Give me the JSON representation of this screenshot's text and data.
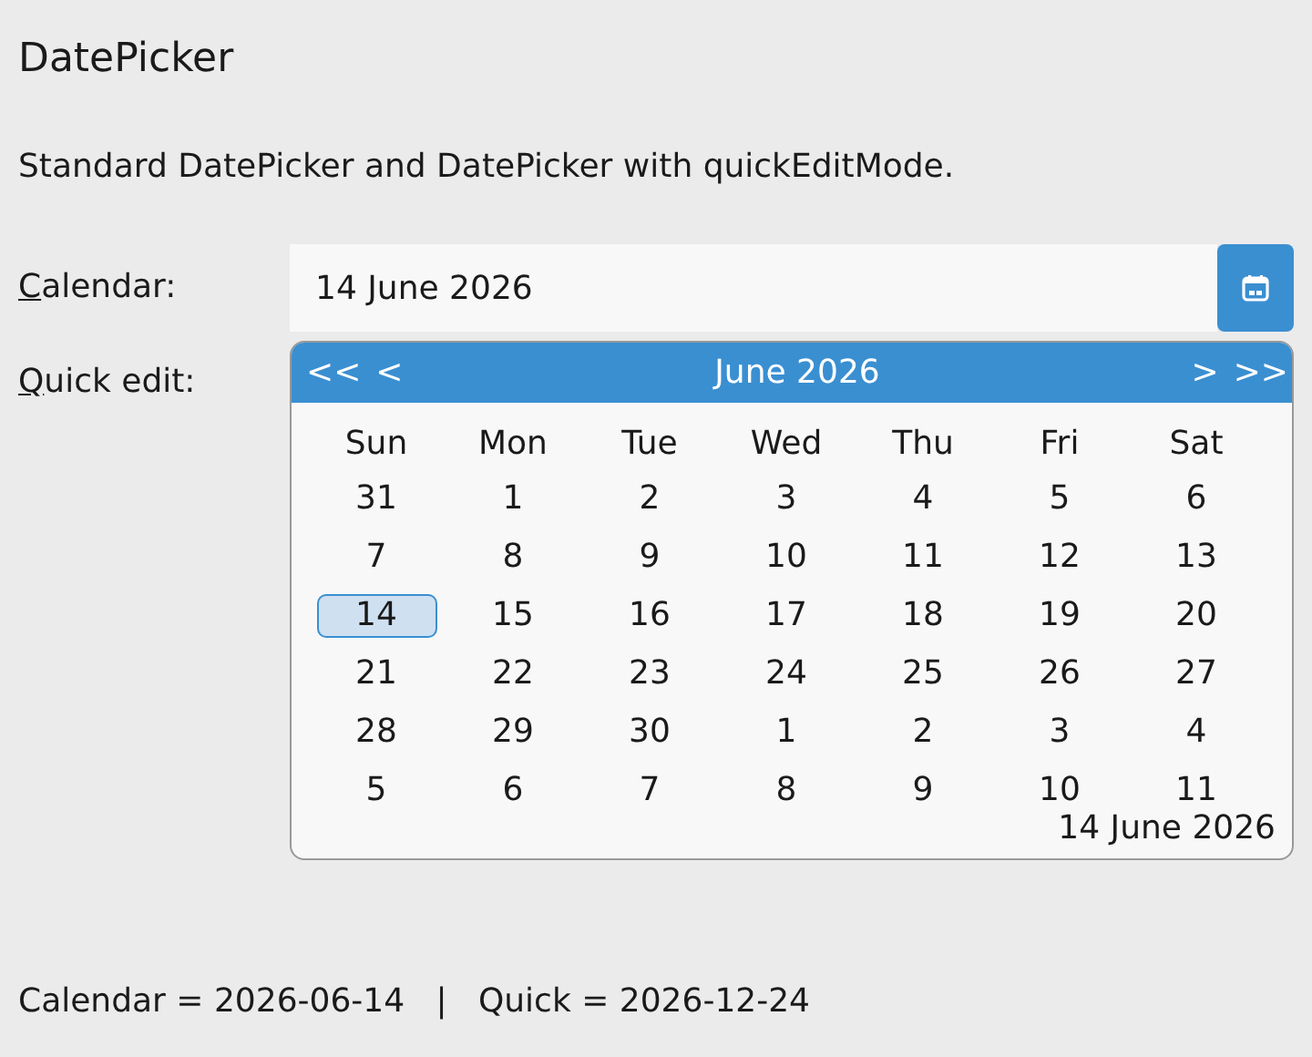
{
  "title": "DatePicker",
  "description": "Standard DatePicker and DatePicker with quickEditMode.",
  "fields": [
    {
      "mnemonic": "C",
      "label_rest": "alendar:",
      "value": "14 June 2026"
    },
    {
      "mnemonic": "Q",
      "label_rest": "uick edit:"
    }
  ],
  "calendar": {
    "open": true,
    "prev_year": "<<",
    "prev_month": "<",
    "month": "June 2026",
    "next_month": ">",
    "next_year": ">>",
    "weekdays": [
      "Sun",
      "Mon",
      "Tue",
      "Wed",
      "Thu",
      "Fri",
      "Sat"
    ],
    "weeks": [
      [
        {
          "day": "31",
          "selected": false
        },
        {
          "day": "1",
          "selected": false
        },
        {
          "day": "2",
          "selected": false
        },
        {
          "day": "3",
          "selected": false
        },
        {
          "day": "4",
          "selected": false
        },
        {
          "day": "5",
          "selected": false
        },
        {
          "day": "6",
          "selected": false
        }
      ],
      [
        {
          "day": "7",
          "selected": false
        },
        {
          "day": "8",
          "selected": false
        },
        {
          "day": "9",
          "selected": false
        },
        {
          "day": "10",
          "selected": false
        },
        {
          "day": "11",
          "selected": false
        },
        {
          "day": "12",
          "selected": false
        },
        {
          "day": "13",
          "selected": false
        }
      ],
      [
        {
          "day": "14",
          "selected": true
        },
        {
          "day": "15",
          "selected": false
        },
        {
          "day": "16",
          "selected": false
        },
        {
          "day": "17",
          "selected": false
        },
        {
          "day": "18",
          "selected": false
        },
        {
          "day": "19",
          "selected": false
        },
        {
          "day": "20",
          "selected": false
        }
      ],
      [
        {
          "day": "21",
          "selected": false
        },
        {
          "day": "22",
          "selected": false
        },
        {
          "day": "23",
          "selected": false
        },
        {
          "day": "24",
          "selected": false
        },
        {
          "day": "25",
          "selected": false
        },
        {
          "day": "26",
          "selected": false
        },
        {
          "day": "27",
          "selected": false
        }
      ],
      [
        {
          "day": "28",
          "selected": false
        },
        {
          "day": "29",
          "selected": false
        },
        {
          "day": "30",
          "selected": false
        },
        {
          "day": "1",
          "selected": false
        },
        {
          "day": "2",
          "selected": false
        },
        {
          "day": "3",
          "selected": false
        },
        {
          "day": "4",
          "selected": false
        }
      ],
      [
        {
          "day": "5",
          "selected": false
        },
        {
          "day": "6",
          "selected": false
        },
        {
          "day": "7",
          "selected": false
        },
        {
          "day": "8",
          "selected": false
        },
        {
          "day": "9",
          "selected": false
        },
        {
          "day": "10",
          "selected": false
        },
        {
          "day": "11",
          "selected": false
        }
      ]
    ],
    "today": "14 June 2026"
  },
  "status": "Calendar = 2026-06-14   |   Quick = 2026-12-24"
}
